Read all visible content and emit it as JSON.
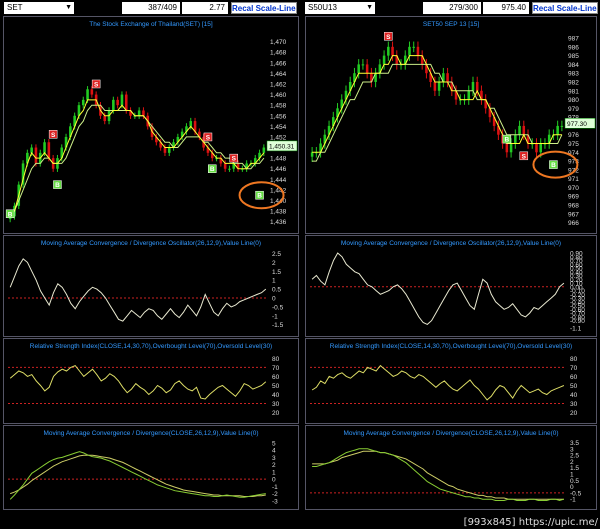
{
  "left": {
    "symbol": "SET",
    "count": "387/409",
    "price": "2.77",
    "button": "Recal Scale-Linear",
    "price_title": "The Stock Exchange of Thailand(SET) [15]",
    "last_price": "1,450.31",
    "price_ticks": [
      "1,470",
      "1,468",
      "1,466",
      "1,464",
      "1,462",
      "1,460",
      "1,458",
      "1,456",
      "1,454",
      "1,452",
      "1,450",
      "1,448",
      "1,446",
      "1,444",
      "1,442",
      "1,440",
      "1,438",
      "1,436"
    ],
    "price_range": [
      1435,
      1472
    ],
    "close": [
      1437,
      1439,
      1443,
      1447,
      1449,
      1450,
      1447,
      1449,
      1451,
      1448,
      1446,
      1448,
      1450,
      1452,
      1454,
      1456,
      1458,
      1459,
      1461,
      1460,
      1458,
      1456,
      1455,
      1457,
      1459,
      1458,
      1460,
      1457,
      1456,
      1456,
      1457,
      1456,
      1454,
      1452,
      1451,
      1450,
      1449,
      1450,
      1451,
      1452,
      1453,
      1454,
      1455,
      1453,
      1452,
      1450,
      1449,
      1448,
      1448,
      1447,
      1446,
      1446,
      1447,
      1446,
      1446,
      1447,
      1447,
      1448,
      1449,
      1450
    ],
    "ma_fast": [
      1437,
      1438,
      1441,
      1444,
      1447,
      1449,
      1448,
      1448,
      1449,
      1448,
      1447,
      1447,
      1448,
      1450,
      1452,
      1454,
      1456,
      1457,
      1459,
      1459,
      1459,
      1457,
      1456,
      1456,
      1457,
      1457,
      1458,
      1457,
      1457,
      1456,
      1456,
      1456,
      1455,
      1453,
      1452,
      1451,
      1450,
      1450,
      1450,
      1451,
      1452,
      1453,
      1454,
      1453,
      1452,
      1451,
      1450,
      1449,
      1448,
      1448,
      1447,
      1447,
      1447,
      1446,
      1446,
      1446,
      1447,
      1447,
      1448,
      1449
    ],
    "ma_slow": [
      1438,
      1438,
      1440,
      1442,
      1444,
      1446,
      1447,
      1447,
      1448,
      1448,
      1447,
      1447,
      1447,
      1448,
      1450,
      1452,
      1454,
      1455,
      1457,
      1458,
      1458,
      1458,
      1457,
      1457,
      1457,
      1457,
      1457,
      1457,
      1457,
      1456,
      1456,
      1456,
      1455,
      1454,
      1453,
      1452,
      1451,
      1451,
      1450,
      1450,
      1451,
      1452,
      1452,
      1452,
      1452,
      1451,
      1451,
      1450,
      1449,
      1449,
      1448,
      1448,
      1447,
      1447,
      1447,
      1446,
      1446,
      1447,
      1447,
      1448
    ],
    "signals": [
      {
        "type": "B",
        "i": 0,
        "v": 1437.5
      },
      {
        "type": "S",
        "i": 10,
        "v": 1452.5
      },
      {
        "type": "B",
        "i": 11,
        "v": 1443
      },
      {
        "type": "S",
        "i": 20,
        "v": 1462
      },
      {
        "type": "S",
        "i": 46,
        "v": 1452
      },
      {
        "type": "B",
        "i": 47,
        "v": 1446
      },
      {
        "type": "S",
        "i": 52,
        "v": 1448
      },
      {
        "type": "B",
        "i": 58,
        "v": 1441
      }
    ],
    "macd_osc": {
      "title": "Moving Average Convergence / Divergence Oscillator(26,12,9),Value Line(0)",
      "ticks": [
        "2.5",
        "2",
        "1.5",
        "1",
        "0.5",
        "0",
        "-0.5",
        "-1",
        "-1.5"
      ],
      "range": [
        -1.8,
        2.7
      ],
      "zero": 0,
      "values": [
        0.6,
        1.2,
        1.8,
        2.2,
        2.0,
        1.5,
        1.0,
        0.4,
        0.0,
        -0.4,
        0.3,
        0.8,
        0.6,
        0.2,
        -0.3,
        -0.6,
        -0.2,
        0.1,
        0.4,
        0.6,
        0.5,
        0.3,
        0.0,
        -0.4,
        -0.8,
        -1.2,
        -1.3,
        -1.0,
        -0.7,
        -0.9,
        -1.1,
        -0.8,
        -0.6,
        -0.7,
        -1.0,
        -1.2,
        -0.9,
        -0.6,
        -0.9,
        -1.1,
        -0.8,
        -0.4,
        -0.7,
        -1.0,
        -0.5,
        0.2,
        -0.3,
        -0.8,
        -1.0,
        -0.6,
        -0.3,
        -0.5,
        -0.4,
        -0.2,
        -0.1,
        0.0,
        0.1,
        0.2,
        0.3,
        0.5
      ]
    },
    "rsi": {
      "title": "Relative Strength Index(CLOSE,14,30,70),Overbought Level(70),Oversold Level(30)",
      "ticks": [
        "80",
        "70",
        "60",
        "50",
        "40",
        "30",
        "20"
      ],
      "range": [
        15,
        86
      ],
      "levels": [
        70,
        30
      ],
      "values": [
        58,
        62,
        66,
        64,
        60,
        62,
        55,
        50,
        44,
        48,
        60,
        65,
        68,
        66,
        70,
        72,
        66,
        60,
        64,
        68,
        62,
        55,
        58,
        63,
        60,
        55,
        48,
        42,
        46,
        52,
        48,
        45,
        40,
        44,
        50,
        47,
        42,
        45,
        52,
        55,
        50,
        46,
        44,
        48,
        36,
        35,
        40,
        44,
        48,
        50,
        46,
        42,
        38,
        44,
        52,
        50,
        46,
        48,
        50,
        54
      ]
    },
    "macd": {
      "title": "Moving Average Convergence / Divergence(CLOSE,26,12,9),Value Line(0)",
      "ticks": [
        "5",
        "4",
        "3",
        "2",
        "1",
        "0",
        "-1",
        "-2",
        "-3"
      ],
      "range": [
        -3.3,
        5.4
      ],
      "zero": 0,
      "macd": [
        -2.8,
        -2.2,
        -1.5,
        -0.8,
        0.0,
        0.8,
        1.2,
        1.6,
        2.0,
        2.4,
        2.7,
        2.9,
        3.0,
        3.2,
        3.4,
        3.6,
        3.8,
        3.6,
        3.3,
        3.1,
        3.0,
        2.9,
        2.7,
        2.5,
        2.2,
        1.9,
        1.6,
        1.3,
        1.0,
        0.7,
        0.4,
        0.1,
        -0.2,
        -0.5,
        -0.8,
        -1.0,
        -1.2,
        -1.4,
        -1.6,
        -1.7,
        -1.8,
        -1.9,
        -2.0,
        -2.1,
        -2.2,
        -2.3,
        -2.3,
        -2.4,
        -2.4,
        -2.3,
        -2.2,
        -2.3,
        -2.4,
        -2.5,
        -2.5,
        -2.4,
        -2.3,
        -2.2,
        -2.1,
        -2.0
      ],
      "signal": [
        -2.0,
        -1.8,
        -1.5,
        -1.1,
        -0.7,
        -0.2,
        0.2,
        0.6,
        1.0,
        1.4,
        1.8,
        2.1,
        2.4,
        2.6,
        2.8,
        3.0,
        3.2,
        3.3,
        3.3,
        3.3,
        3.2,
        3.1,
        3.0,
        2.9,
        2.7,
        2.5,
        2.3,
        2.0,
        1.7,
        1.4,
        1.1,
        0.8,
        0.5,
        0.2,
        -0.1,
        -0.4,
        -0.7,
        -0.9,
        -1.1,
        -1.3,
        -1.5,
        -1.6,
        -1.7,
        -1.8,
        -1.9,
        -2.0,
        -2.1,
        -2.2,
        -2.2,
        -2.3,
        -2.3,
        -2.3,
        -2.3,
        -2.3,
        -2.4,
        -2.4,
        -2.4,
        -2.3,
        -2.3,
        -2.2
      ]
    }
  },
  "right": {
    "symbol": "S50U13",
    "count": "279/300",
    "price": "975.40",
    "button": "Recal Scale-Linear",
    "price_title": "SET50 SEP 13    [15]",
    "last_price": "977.30",
    "price_ticks": [
      "987",
      "986",
      "985",
      "984",
      "983",
      "982",
      "981",
      "980",
      "979",
      "978",
      "977",
      "976",
      "975",
      "974",
      "973",
      "972",
      "971",
      "970",
      "969",
      "968",
      "967",
      "966"
    ],
    "price_range": [
      965.5,
      987.8
    ],
    "close": [
      974,
      974,
      975,
      976,
      977,
      978,
      979,
      980,
      981,
      982,
      983,
      984,
      984,
      983,
      982,
      983,
      984,
      985,
      986,
      985,
      984,
      984,
      985,
      986,
      986,
      985,
      984,
      983,
      982,
      981,
      982,
      983,
      982,
      981,
      980,
      980,
      980,
      981,
      982,
      981,
      980,
      979,
      978,
      977,
      976,
      975,
      974,
      975,
      976,
      977,
      976,
      975,
      975,
      974,
      975,
      975,
      976,
      976,
      977,
      977
    ],
    "ma_fast": [
      974,
      974,
      974,
      975,
      976,
      977,
      978,
      979,
      980,
      981,
      982,
      983,
      983,
      983,
      983,
      983,
      983,
      984,
      984,
      985,
      985,
      984,
      984,
      985,
      985,
      985,
      985,
      984,
      983,
      982,
      982,
      982,
      982,
      981,
      981,
      980,
      980,
      980,
      980,
      981,
      980,
      980,
      979,
      978,
      977,
      976,
      975,
      975,
      975,
      975,
      976,
      975,
      975,
      975,
      975,
      975,
      975,
      976,
      976,
      976
    ],
    "ma_slow": [
      973,
      973,
      974,
      974,
      975,
      976,
      977,
      978,
      979,
      980,
      980,
      981,
      982,
      982,
      982,
      983,
      983,
      983,
      983,
      984,
      984,
      984,
      984,
      984,
      984,
      984,
      984,
      984,
      984,
      983,
      983,
      982,
      982,
      982,
      981,
      981,
      981,
      981,
      981,
      980,
      980,
      980,
      979,
      979,
      978,
      977,
      976,
      976,
      976,
      976,
      976,
      976,
      975,
      975,
      975,
      975,
      975,
      975,
      975,
      976
    ],
    "signals": [
      {
        "type": "S",
        "i": 18,
        "v": 987.2
      },
      {
        "type": "B",
        "i": 46,
        "v": 975.5
      },
      {
        "type": "S",
        "i": 50,
        "v": 973.6
      },
      {
        "type": "B",
        "i": 57,
        "v": 972.6
      }
    ],
    "macd_osc": {
      "title": "Moving Average Convergence / Divergence Oscillator(26,12,9),Value Line(0)",
      "ticks": [
        "0.90",
        "0.80",
        "0.70",
        "0.60",
        "0.50",
        "0.40",
        "0.30",
        "0.20",
        "0.10",
        "0.00",
        "-0.10",
        "-0.20",
        "-0.30",
        "-0.40",
        "-0.50",
        "-0.60",
        "-0.70",
        "-0.80",
        "-0.90",
        "-1.1"
      ],
      "range": [
        -1.15,
        0.98
      ],
      "zero": 0,
      "values": [
        0.2,
        0.3,
        0.15,
        0.05,
        0.4,
        0.7,
        0.9,
        0.8,
        0.6,
        0.5,
        0.4,
        0.35,
        0.2,
        0.05,
        0.0,
        -0.1,
        -0.2,
        -0.15,
        -0.1,
        0.0,
        0.05,
        -0.05,
        -0.2,
        -0.4,
        -0.6,
        -0.8,
        -0.95,
        -1.0,
        -0.9,
        -0.7,
        -0.5,
        -0.3,
        -0.1,
        0.05,
        0.1,
        -0.1,
        -0.3,
        -0.5,
        -0.6,
        -0.2,
        0.2,
        0.1,
        -0.2,
        -0.4,
        -0.5,
        -0.6,
        -0.55,
        -0.45,
        -0.6,
        -0.75,
        -0.8,
        -0.7,
        -0.55,
        -0.6,
        -0.5,
        -0.4,
        -0.3,
        -0.2,
        0.0,
        0.1
      ]
    },
    "rsi": {
      "title": "Relative Strength Index(CLOSE,14,30,70),Overbought Level(70),Oversold Level(30)",
      "ticks": [
        "80",
        "70",
        "60",
        "50",
        "40",
        "30",
        "20"
      ],
      "range": [
        15,
        86
      ],
      "levels": [
        70,
        30
      ],
      "values": [
        45,
        48,
        55,
        52,
        60,
        58,
        62,
        64,
        60,
        58,
        62,
        66,
        64,
        70,
        68,
        66,
        72,
        68,
        64,
        60,
        62,
        66,
        64,
        60,
        58,
        62,
        60,
        56,
        52,
        48,
        52,
        55,
        50,
        46,
        44,
        48,
        52,
        56,
        50,
        46,
        40,
        34,
        38,
        45,
        50,
        48,
        42,
        36,
        44,
        50,
        46,
        42,
        44,
        46,
        42,
        40,
        44,
        46,
        48,
        50
      ]
    },
    "macd": {
      "title": "Moving Average Convergence / Divergence(CLOSE,26,12,9),Value Line(0)",
      "ticks": [
        "3.5",
        "3",
        "2.5",
        "2",
        "1.5",
        "1",
        "0.5",
        "0",
        "-0.5",
        "-1"
      ],
      "range": [
        -1.3,
        3.7
      ],
      "zero": -0.5,
      "macd": [
        1.6,
        1.6,
        1.7,
        1.8,
        1.9,
        2.1,
        2.3,
        2.5,
        2.7,
        2.8,
        2.9,
        3.0,
        3.0,
        3.0,
        2.9,
        2.8,
        2.7,
        2.7,
        2.6,
        2.5,
        2.3,
        2.1,
        1.9,
        1.6,
        1.3,
        1.0,
        0.7,
        0.4,
        0.2,
        0.0,
        -0.2,
        -0.3,
        -0.4,
        -0.5,
        -0.6,
        -0.7,
        -0.8,
        -0.8,
        -0.9,
        -0.9,
        -1.0,
        -1.0,
        -1.0,
        -1.1,
        -1.1,
        -1.1,
        -1.0,
        -1.0,
        -1.1,
        -1.1,
        -1.1,
        -1.0,
        -1.0,
        -1.1,
        -1.1,
        -1.1,
        -1.0,
        -1.0,
        -1.1,
        -1.0
      ],
      "signal": [
        1.8,
        1.8,
        1.8,
        1.8,
        1.9,
        2.0,
        2.1,
        2.3,
        2.4,
        2.5,
        2.6,
        2.7,
        2.8,
        2.8,
        2.8,
        2.8,
        2.7,
        2.7,
        2.6,
        2.5,
        2.4,
        2.3,
        2.2,
        2.0,
        1.8,
        1.6,
        1.4,
        1.1,
        0.9,
        0.7,
        0.5,
        0.3,
        0.1,
        0.0,
        -0.2,
        -0.3,
        -0.4,
        -0.5,
        -0.6,
        -0.7,
        -0.7,
        -0.8,
        -0.8,
        -0.9,
        -0.9,
        -0.9,
        -1.0,
        -1.0,
        -1.0,
        -1.0,
        -1.0,
        -1.0,
        -1.0,
        -1.0,
        -1.0,
        -1.0,
        -1.0,
        -1.0,
        -1.0,
        -1.0
      ]
    }
  },
  "colors": {
    "bull": "#22cc22",
    "bear": "#dd1111",
    "ma_fast": "#ffff33",
    "ma_slow": "#ccee88",
    "osc_line": "#e8e8d0",
    "rsi_line": "#dddd66",
    "macd_line": "#88cc33",
    "signal_line": "#cccc66",
    "level_line": "#cc2222",
    "title": "#3399ff",
    "highlight": "#ee7722"
  },
  "chart_data": [
    {
      "type": "line",
      "title": "The Stock Exchange of Thailand(SET) [15]",
      "ylim": [
        1436,
        1470
      ],
      "series": [
        {
          "name": "SET",
          "values": "see left.close"
        }
      ]
    },
    {
      "type": "line",
      "title": "SET50 SEP 13    [15]",
      "ylim": [
        966,
        987
      ],
      "series": [
        {
          "name": "S50U13",
          "values": "see right.close"
        }
      ]
    }
  ],
  "watermark": "[993x845]   https://upic.me/"
}
